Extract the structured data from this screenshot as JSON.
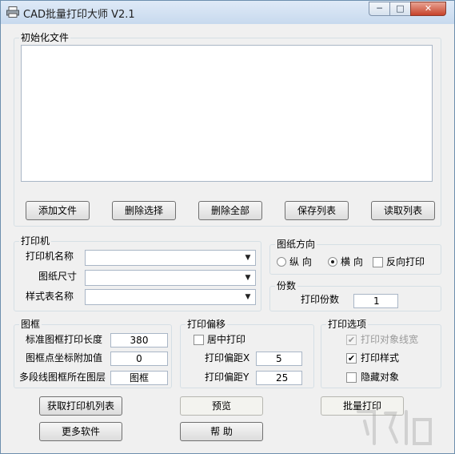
{
  "window": {
    "title": "CAD批量打印大师 V2.1",
    "controls": {
      "minimize": "─",
      "maximize": "□",
      "close": "✕"
    }
  },
  "file_group": {
    "legend": "初始化文件",
    "buttons": {
      "add": "添加文件",
      "delete_selected": "删除选择",
      "delete_all": "删除全部",
      "save_list": "保存列表",
      "load_list": "读取列表"
    }
  },
  "printer_group": {
    "legend": "打印机",
    "printer_name_label": "打印机名称",
    "printer_name_value": "",
    "paper_size_label": "图纸尺寸",
    "paper_size_value": "",
    "style_table_label": "样式表名称",
    "style_table_value": ""
  },
  "orientation_group": {
    "legend": "图纸方向",
    "portrait": "纵 向",
    "landscape": "横 向",
    "reverse": "反向打印",
    "selected": "landscape"
  },
  "copies_group": {
    "legend": "份数",
    "label": "打印份数",
    "value": "1"
  },
  "frame_group": {
    "legend": "图框",
    "length_label": "标准图框打印长度",
    "length_value": "380",
    "offset_label": "图框点坐标附加值",
    "offset_value": "0",
    "layer_label": "多段线图框所在图层",
    "layer_value": "图框"
  },
  "offset_group": {
    "legend": "打印偏移",
    "center_label": "居中打印",
    "center_checked": false,
    "x_label": "打印偏距X",
    "x_value": "5",
    "y_label": "打印偏距Y",
    "y_value": "25"
  },
  "options_group": {
    "legend": "打印选项",
    "lineweight_label": "打印对象线宽",
    "lineweight_checked": true,
    "style_label": "打印样式",
    "style_checked": true,
    "hide_label": "隐藏对象",
    "hide_checked": false
  },
  "bottom_buttons": {
    "get_printers": "获取打印机列表",
    "more_software": "更多软件",
    "preview": "预览",
    "help": "帮 助",
    "batch_print": "批量打印"
  },
  "icons": {
    "check_mark": "✔",
    "combo_arrow": "▼"
  }
}
